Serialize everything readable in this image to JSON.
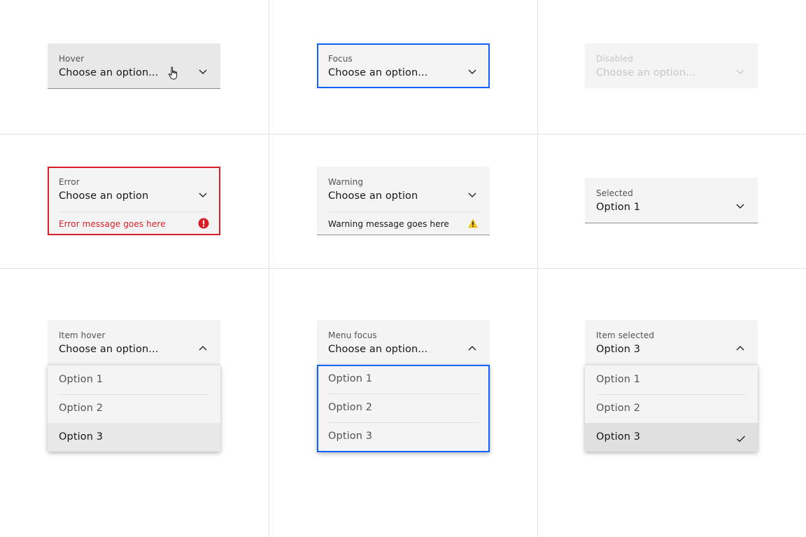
{
  "colors": {
    "field_bg": "#f4f4f4",
    "hover_bg": "#e8e8e8",
    "selected_bg": "#e0e0e0",
    "focus": "#0f62fe",
    "error": "#da1e28",
    "warning": "#f1c21b",
    "text_primary": "#161616",
    "text_secondary": "#525252",
    "text_disabled": "#c6c6c6"
  },
  "states": {
    "hover": {
      "label": "Hover",
      "value": "Choose an option...",
      "icon": "chevron-down-icon"
    },
    "focus": {
      "label": "Focus",
      "value": "Choose an option...",
      "icon": "chevron-down-icon"
    },
    "disabled": {
      "label": "Disabled",
      "value": "Choose an option...",
      "icon": "chevron-down-icon"
    },
    "error": {
      "label": "Error",
      "value": "Choose an option",
      "message": "Error message goes here",
      "icon": "error-filled-icon"
    },
    "warning": {
      "label": "Warning",
      "value": "Choose an option",
      "message": "Warning message goes here",
      "icon": "warning-filled-icon"
    },
    "selected": {
      "label": "Selected",
      "value": "Option 1",
      "icon": "chevron-down-icon"
    },
    "item_hover": {
      "label": "Item hover",
      "value": "Choose an option...",
      "icon": "chevron-up-icon",
      "options": [
        "Option 1",
        "Option 2",
        "Option 3"
      ],
      "hovered_option": "Option 3"
    },
    "menu_focus": {
      "label": "Menu focus",
      "value": "Choose an option...",
      "icon": "chevron-up-icon",
      "options": [
        "Option 1",
        "Option 2",
        "Option 3"
      ]
    },
    "item_selected": {
      "label": "Item selected",
      "value": "Option 3",
      "icon": "chevron-up-icon",
      "options": [
        "Option 1",
        "Option 2",
        "Option 3"
      ],
      "selected_option": "Option 3"
    }
  }
}
